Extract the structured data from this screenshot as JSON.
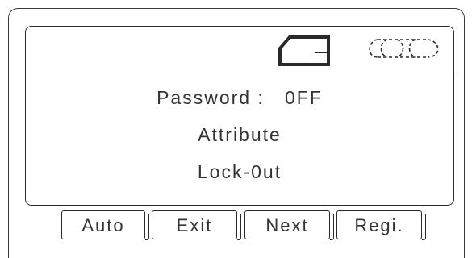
{
  "display": {
    "status_icons": [
      "card-icon",
      "dial-icon"
    ],
    "lines": [
      "Password :   0FF",
      "Attribute",
      "Lock-0ut"
    ]
  },
  "soft_keys": [
    "Auto",
    "Exit",
    "Next",
    "Regi."
  ]
}
